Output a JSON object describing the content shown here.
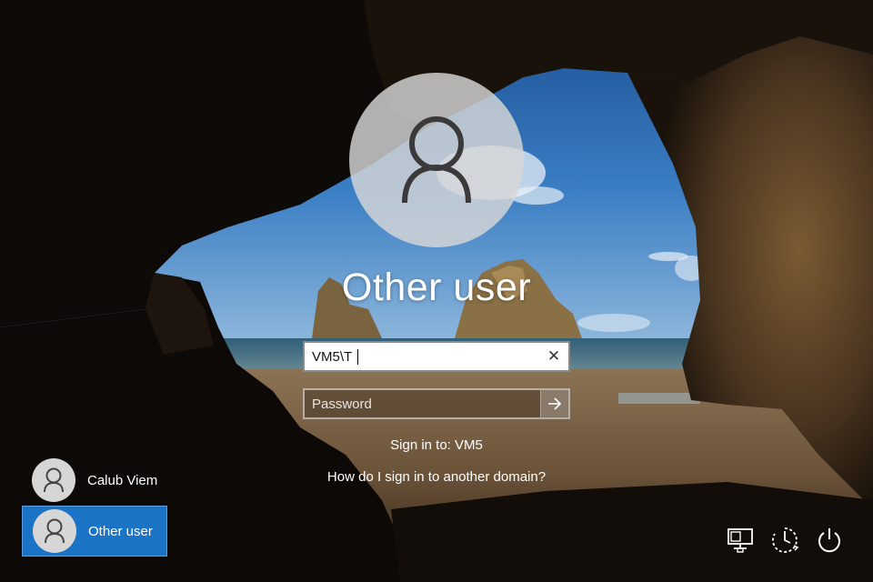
{
  "login": {
    "user_title": "Other user",
    "username_value": "VM5\\T",
    "password_placeholder": "Password",
    "sign_in_to": "Sign in to: VM5",
    "domain_help_link": "How do I sign in to another domain?"
  },
  "user_list": [
    {
      "label": "Calub Viem",
      "selected": false
    },
    {
      "label": "Other user",
      "selected": true
    }
  ],
  "system_icons": [
    "network-icon",
    "ease-of-access-icon",
    "power-icon"
  ],
  "colors": {
    "selected_tile": "#1a73c5",
    "avatar_bg": "#d6d6d6"
  }
}
